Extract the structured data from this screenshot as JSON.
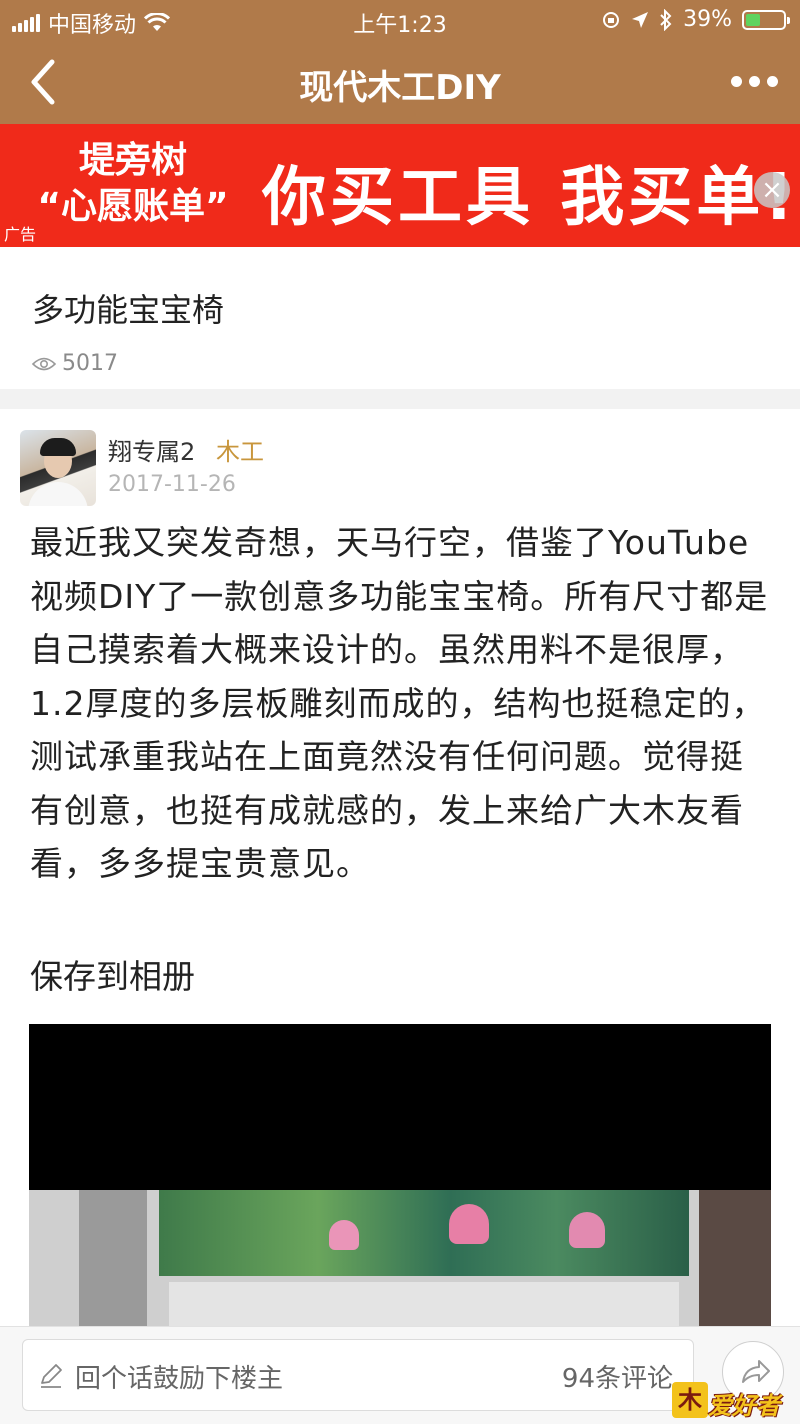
{
  "status_bar": {
    "carrier": "中国移动",
    "time": "上午1:23",
    "battery_percent": "39%",
    "battery_level": 0.39,
    "battery_color": "#5fd35f"
  },
  "nav": {
    "title": "现代木工DIY",
    "back_icon": "chevron-left-icon",
    "more_icon": "more-dots-icon"
  },
  "ad": {
    "left_line1": "堤旁树",
    "left_line2": "“心愿账单”",
    "main_text": "你买工具  我买单!",
    "tag": "广告",
    "close": "×",
    "background": "#f02a1a"
  },
  "post": {
    "title": "多功能宝宝椅",
    "views": "5017",
    "author": {
      "name": "翔专属2",
      "badge": "木工",
      "date": "2017-11-26"
    },
    "body": "最近我又突发奇想，天马行空，借鉴了YouTube视频DIY了一款创意多功能宝宝椅。所有尺寸都是自己摸索着大概来设计的。虽然用料不是很厚，1.2厚度的多层板雕刻而成的，结构也挺稳定的，测试承重我站在上面竟然没有任何问题。觉得挺有创意，也挺有成就感的，发上来给广大木友看看，多多提宝贵意见。",
    "save_to_album": "保存到相册"
  },
  "bottom_bar": {
    "comment_placeholder": "回个话鼓励下楼主",
    "comment_count": "94条评论",
    "share_icon": "share-icon"
  },
  "watermark": {
    "logo_char": "木",
    "text": "爱好者"
  },
  "colors": {
    "brand": "#b07a4a",
    "badge": "#c8963c"
  }
}
